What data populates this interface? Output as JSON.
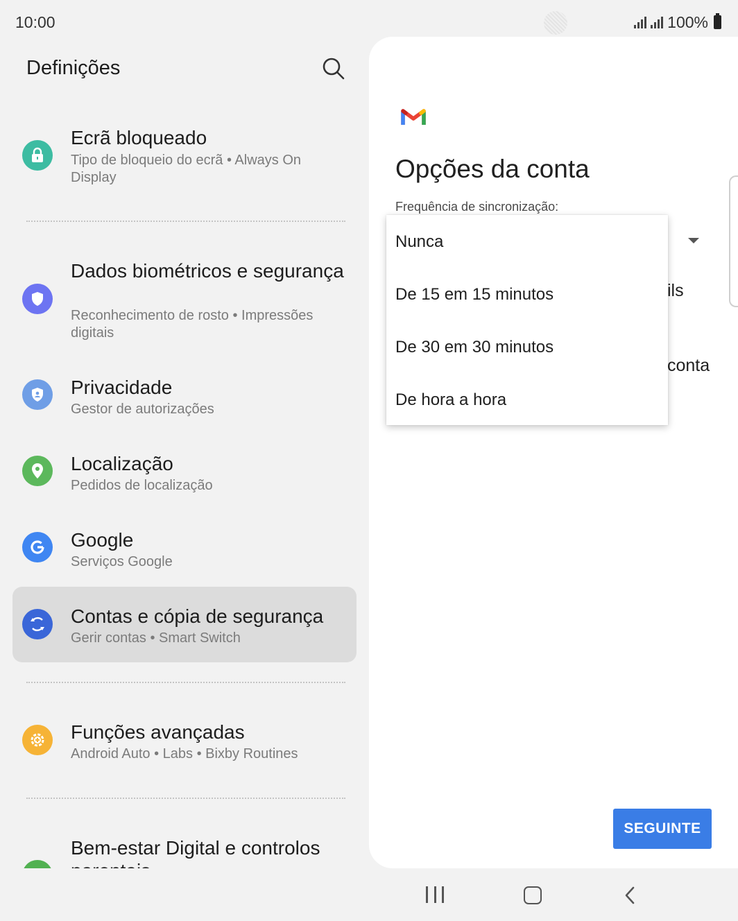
{
  "status_bar": {
    "time": "10:00",
    "battery": "100%"
  },
  "left_panel": {
    "title": "Definições",
    "items": [
      {
        "title": "Ecrã bloqueado",
        "subtitle": "Tipo de bloqueio do ecrã  •  Always On Display",
        "icon": "lock-icon",
        "color": "#3dbca2"
      },
      {
        "title": "Dados biométricos e segurança",
        "subtitle": "Reconhecimento de rosto  •  Impressões digitais",
        "icon": "shield-icon",
        "color": "#6d74f2"
      },
      {
        "title": "Privacidade",
        "subtitle": "Gestor de autorizações",
        "icon": "privacy-shield-icon",
        "color": "#6f9ee6"
      },
      {
        "title": "Localização",
        "subtitle": "Pedidos de localização",
        "icon": "location-pin-icon",
        "color": "#5cb85c"
      },
      {
        "title": "Google",
        "subtitle": "Serviços Google",
        "icon": "google-icon",
        "color": "#3f86f2"
      },
      {
        "title": "Contas e cópia de segurança",
        "subtitle": "Gerir contas  •  Smart Switch",
        "icon": "sync-icon",
        "color": "#3a66d8"
      },
      {
        "title": "Funções avançadas",
        "subtitle": "Android Auto  •  Labs  •  Bixby Routines",
        "icon": "gear-plus-icon",
        "color": "#f6b336"
      },
      {
        "title": "Bem-estar Digital e controlos parentais",
        "subtitle": "",
        "icon": "wellbeing-icon",
        "color": "#52b152"
      }
    ]
  },
  "right_panel": {
    "title": "Opções da conta",
    "field_label": "Frequência de sincronização:",
    "peek_text_1": "ils",
    "peek_text_2": "conta",
    "next_button": "SEGUINTE"
  },
  "menu": {
    "options": [
      "Nunca",
      "De 15 em 15 minutos",
      "De 30 em 30 minutos",
      "De hora a hora"
    ]
  }
}
